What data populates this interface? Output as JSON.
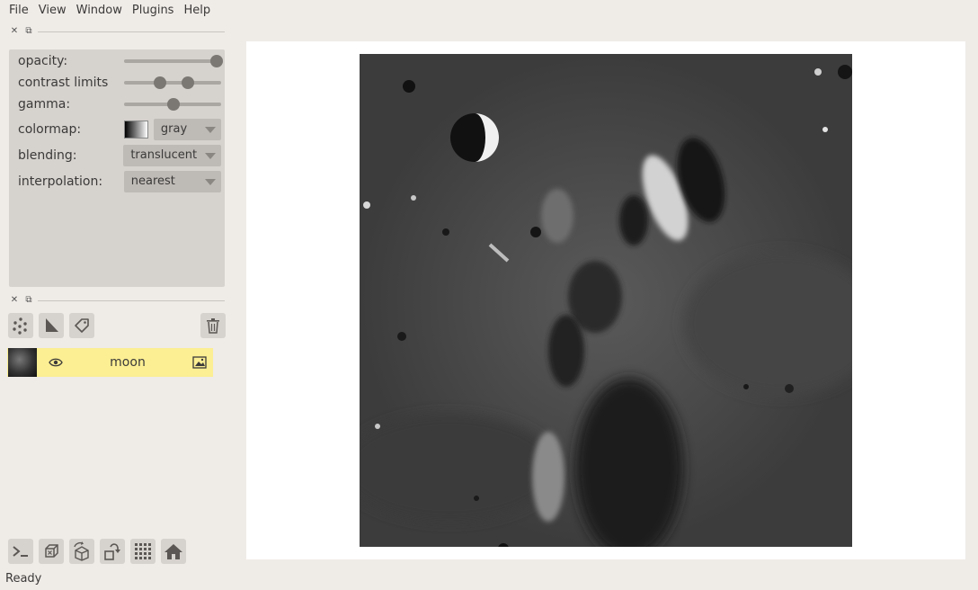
{
  "menu": {
    "file": "File",
    "view": "View",
    "window": "Window",
    "plugins": "Plugins",
    "help": "Help"
  },
  "dock": {
    "close_glyph": "✕",
    "float_glyph": "⧉"
  },
  "layer_controls": {
    "opacity": {
      "label": "opacity:",
      "value": 1.0
    },
    "contrast_limits": {
      "label": "contrast limits",
      "low": 0.34,
      "high": 0.66
    },
    "gamma": {
      "label": "gamma:",
      "value": 0.5
    },
    "colormap": {
      "label": "colormap:",
      "value": "gray"
    },
    "blending": {
      "label": "blending:",
      "value": "translucent"
    },
    "interpolation": {
      "label": "interpolation:",
      "value": "nearest"
    }
  },
  "layer_tools": {
    "new_points": "points-icon",
    "new_shapes": "shapes-icon",
    "new_labels": "labels-icon",
    "delete": "trash-icon"
  },
  "layers": [
    {
      "name": "moon",
      "visible": true,
      "type_icon": "image-icon"
    }
  ],
  "console_buttons": [
    "console-icon",
    "ndisplay-icon",
    "roll-icon",
    "transpose-icon",
    "grid-icon",
    "home-icon"
  ],
  "status": {
    "text": "Ready"
  },
  "colors": {
    "background": "#efebe7",
    "panel": "#d6d2ce",
    "selected_layer": "#fbee93",
    "canvas": "#ffffff"
  }
}
